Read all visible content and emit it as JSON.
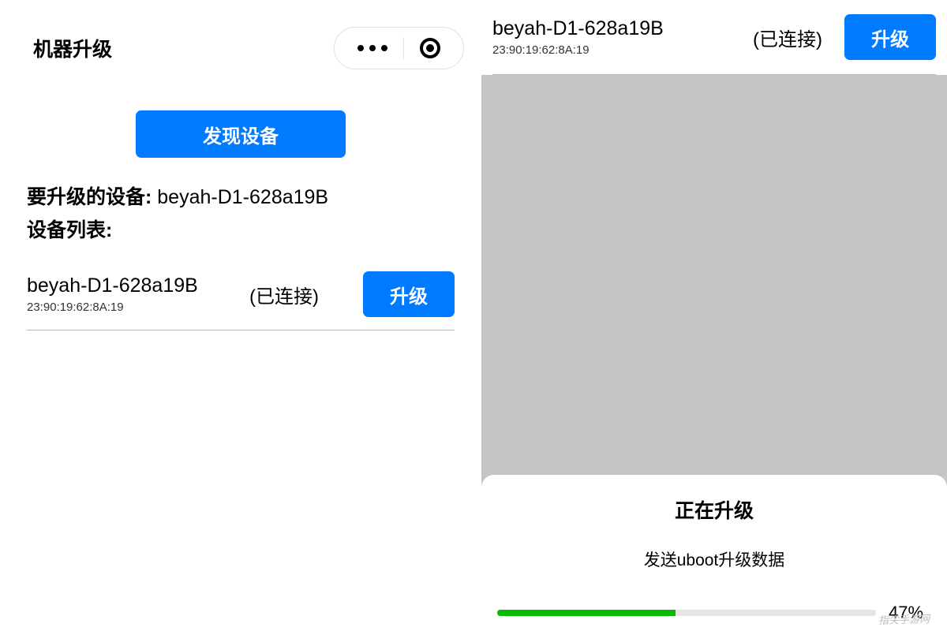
{
  "left": {
    "title": "机器升级",
    "discover_label": "发现设备",
    "target_prefix": "要升级的设备: ",
    "target_device": "beyah-D1-628a19B",
    "list_label": "设备列表:",
    "device": {
      "name": "beyah-D1-628a19B",
      "mac": "23:90:19:62:8A:19",
      "status": "(已连接)",
      "action_label": "升级"
    }
  },
  "right": {
    "device": {
      "name": "beyah-D1-628a19B",
      "mac": "23:90:19:62:8A:19",
      "status": "(已连接)",
      "action_label": "升级"
    },
    "sheet": {
      "title": "正在升级",
      "subtitle": "发送uboot升级数据",
      "percent": 47,
      "percent_label": "47%"
    }
  },
  "watermark": "指尖手游网"
}
